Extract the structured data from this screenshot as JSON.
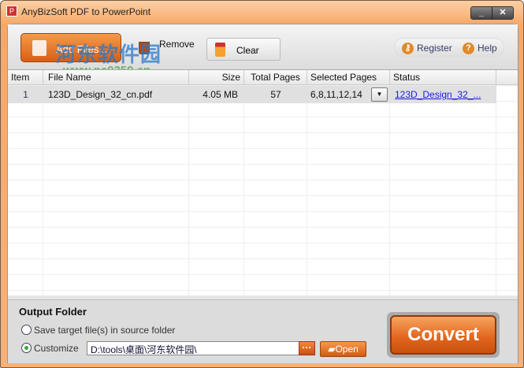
{
  "window": {
    "title": "AnyBizSoft PDF to PowerPoint",
    "minimize": "_",
    "close": "✕"
  },
  "toolbar": {
    "add_files": "Add Files...",
    "remove": "Remove",
    "clear": "Clear",
    "register": "Register",
    "help": "Help"
  },
  "table": {
    "headers": [
      "Item",
      "File Name",
      "Size",
      "Total Pages",
      "Selected Pages",
      "Status"
    ],
    "rows": [
      {
        "item": "1",
        "file_name": "123D_Design_32_cn.pdf",
        "size": "4.05  MB",
        "total_pages": "57",
        "selected_pages": "6,8,11,12,14",
        "status": "123D_Design_32_..."
      }
    ]
  },
  "output": {
    "title": "Output Folder",
    "option_source": "Save target file(s) in source folder",
    "option_custom": "Customize",
    "path": "D:\\tools\\桌面\\河东软件园\\",
    "browse": "···",
    "open": "Open",
    "selected": "custom"
  },
  "convert": "Convert",
  "watermark": {
    "text": "河东软件园",
    "url": "www.pc0359.cn"
  },
  "colors": {
    "accent": "#e0641c",
    "link": "#1a1adf"
  }
}
